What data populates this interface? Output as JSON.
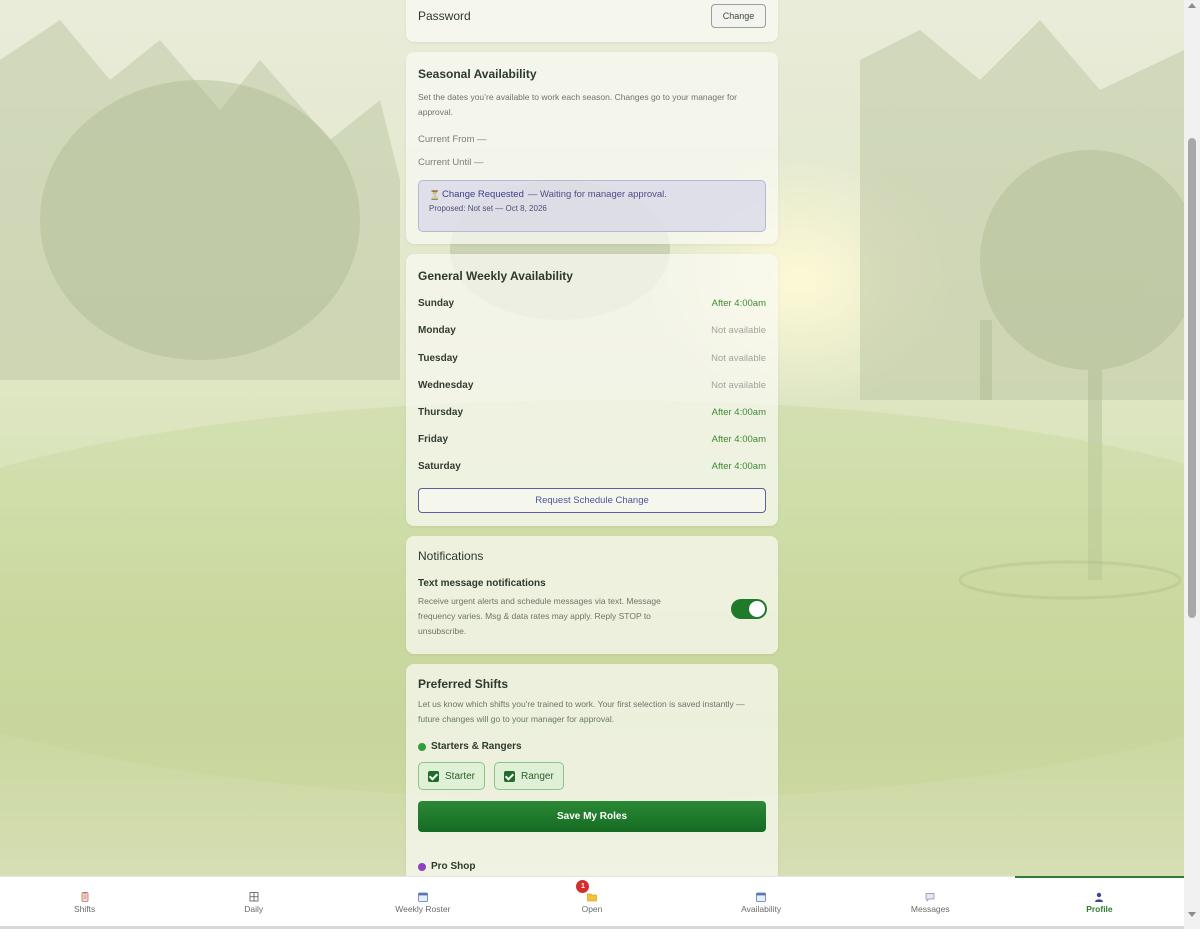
{
  "password": {
    "label": "Password",
    "button": "Change"
  },
  "seasonal": {
    "title": "Seasonal Availability",
    "description": "Set the dates you’re available to work each season. Changes go to your manager for approval.",
    "current_from_label": "Current From",
    "current_from_value": "—",
    "current_until_label": "Current Until",
    "current_until_value": "—",
    "pending": {
      "status": "Change Requested",
      "message": "— Waiting for manager approval.",
      "proposed": "Proposed: Not set — Oct 8, 2026"
    }
  },
  "weekly": {
    "title": "General Weekly Availability",
    "days": [
      {
        "name": "Sunday",
        "value": "After 4:00am",
        "available": true
      },
      {
        "name": "Monday",
        "value": "Not available",
        "available": false
      },
      {
        "name": "Tuesday",
        "value": "Not available",
        "available": false
      },
      {
        "name": "Wednesday",
        "value": "Not available",
        "available": false
      },
      {
        "name": "Thursday",
        "value": "After 4:00am",
        "available": true
      },
      {
        "name": "Friday",
        "value": "After 4:00am",
        "available": true
      },
      {
        "name": "Saturday",
        "value": "After 4:00am",
        "available": true
      }
    ],
    "request_button": "Request Schedule Change"
  },
  "notifications": {
    "title": "Notifications",
    "sms_label": "Text message notifications",
    "sms_description": "Receive urgent alerts and schedule messages via text. Message frequency varies. Msg & data rates may apply. Reply STOP to unsubscribe.",
    "sms_enabled": true
  },
  "preferred_shifts": {
    "title": "Preferred Shifts",
    "description": "Let us know which shifts you're trained to work. Your first selection is saved instantly — future changes will go to your manager for approval.",
    "groups": [
      {
        "name": "Starters & Rangers",
        "color": "#2e9e3a",
        "roles": [
          "Starter",
          "Ranger"
        ]
      },
      {
        "name": "Pro Shop",
        "color": "#8e3fc4",
        "roles": []
      }
    ],
    "save_button": "Save My Roles"
  },
  "nav": {
    "items": [
      {
        "label": "Shifts",
        "icon": "clipboard-icon"
      },
      {
        "label": "Daily",
        "icon": "grid-icon"
      },
      {
        "label": "Weekly Roster",
        "icon": "calendar-icon"
      },
      {
        "label": "Open",
        "icon": "folder-icon",
        "badge": "1"
      },
      {
        "label": "Availability",
        "icon": "calendar-icon"
      },
      {
        "label": "Messages",
        "icon": "chat-icon"
      },
      {
        "label": "Profile",
        "icon": "user-icon",
        "active": true
      }
    ]
  },
  "colors": {
    "accent": "#2e7d32",
    "pending_bg": "#d6d6e8",
    "badge": "#d32f2f"
  }
}
